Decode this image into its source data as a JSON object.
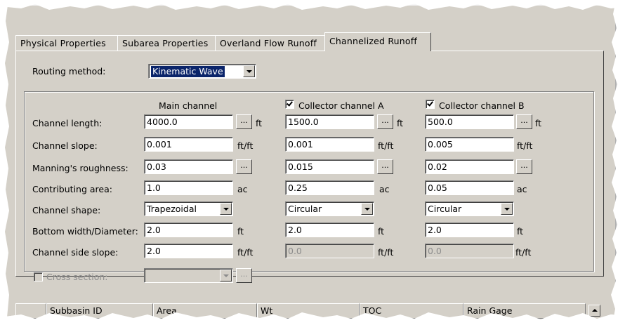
{
  "tabs": [
    {
      "label": "Physical Properties"
    },
    {
      "label": "Subarea Properties"
    },
    {
      "label": "Overland Flow Runoff"
    },
    {
      "label": "Channelized Runoff"
    }
  ],
  "routing": {
    "label": "Routing method:",
    "value": "Kinematic Wave"
  },
  "columns": {
    "main": "Main channel",
    "a": {
      "label": "Collector channel A",
      "checked": true
    },
    "b": {
      "label": "Collector channel B",
      "checked": true
    }
  },
  "rows": [
    {
      "label": "Channel length:",
      "main": "4000.0",
      "main_unit": "ft",
      "a": "1500.0",
      "a_unit": "ft",
      "b": "500.0",
      "b_unit": "ft",
      "button": "..."
    },
    {
      "label": "Channel slope:",
      "main": "0.001",
      "main_unit": "ft/ft",
      "a": "0.001",
      "a_unit": "ft/ft",
      "b": "0.005",
      "b_unit": "ft/ft"
    },
    {
      "label": "Manning's roughness:",
      "main": "0.03",
      "a": "0.015",
      "b": "0.02",
      "button": "..."
    },
    {
      "label": "Contributing area:",
      "main": "1.0",
      "main_unit": "ac",
      "a": "0.25",
      "a_unit": "ac",
      "b": "0.05",
      "b_unit": "ac"
    },
    {
      "label": "Channel shape:",
      "main": "Trapezoidal",
      "a": "Circular",
      "b": "Circular"
    },
    {
      "label": "Bottom width/Diameter:",
      "main": "2.0",
      "main_unit": "ft",
      "a": "2.0",
      "a_unit": "ft",
      "b": "2.0",
      "b_unit": "ft"
    },
    {
      "label": "Channel side slope:",
      "main": "2.0",
      "main_unit": "ft/ft",
      "a": "0.0",
      "a_unit": "ft/ft",
      "b": "0.0",
      "b_unit": "ft/ft"
    }
  ],
  "cross_section": {
    "label": "Cross section:",
    "checked": false,
    "value": "",
    "button": "..."
  },
  "grid": {
    "headers": [
      "",
      "Subbasin ID",
      "Area",
      "Wt",
      "TOC",
      "Rain Gage"
    ]
  },
  "colors": {
    "panel": "#d4d0c8",
    "selection": "#0a246a"
  }
}
